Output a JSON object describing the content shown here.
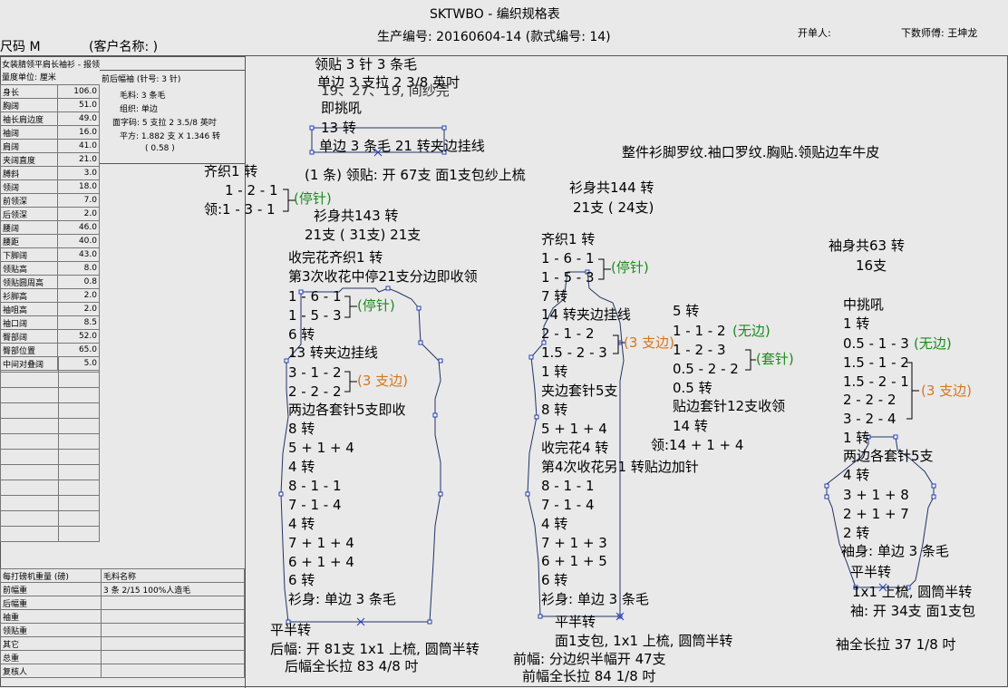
{
  "header": {
    "title": "SKTWBO - 编织规格表",
    "production": "生产编号: 20160604-14  (款式编号: 14)",
    "size": "尺码  M",
    "customer": "(客户名称:                    )",
    "order_person": "开单人:",
    "master": "下数师傅: 王坤龙"
  },
  "left": {
    "title": "女装腈领平肩长袖衫 - 报领",
    "unit": "量度单位: 厘米",
    "rows": [
      {
        "label": "身长",
        "value": "106.0"
      },
      {
        "label": "胸阔",
        "value": "51.0"
      },
      {
        "label": "袖长肩边度",
        "value": "49.0"
      },
      {
        "label": "袖阔",
        "value": "16.0"
      },
      {
        "label": "肩阔",
        "value": "41.0"
      },
      {
        "label": "夹阔直度",
        "value": "21.0"
      },
      {
        "label": "膊斜",
        "value": "3.0"
      },
      {
        "label": "领阔",
        "value": "18.0"
      },
      {
        "label": "前领深",
        "value": "7.0"
      },
      {
        "label": "后领深",
        "value": "2.0"
      },
      {
        "label": "腰阔",
        "value": "46.0"
      },
      {
        "label": "腰距",
        "value": "40.0"
      },
      {
        "label": "下脚阔",
        "value": "43.0"
      },
      {
        "label": "领贴高",
        "value": "8.0"
      },
      {
        "label": "领贴圆周高",
        "value": "0.8"
      },
      {
        "label": "衫脚高",
        "value": "2.0"
      },
      {
        "label": "袖咀高",
        "value": "2.0"
      },
      {
        "label": "袖口阔",
        "value": "8.5"
      },
      {
        "label": "臀部阔",
        "value": "52.0"
      },
      {
        "label": "臀部位置",
        "value": "65.0"
      },
      {
        "label": "中间对叠阔",
        "value": "5.0"
      }
    ],
    "yarn": {
      "header": "前后幅袖 (针号: 3 针)",
      "material": "毛料: 3 条毛",
      "stitch": "组织: 单边",
      "gauge": "面字码: 5 支拉 2 3.5/8 英吋",
      "flat": "平方: 1.882 支 X 1.346 转",
      "flat2": "( 0.58 )"
    },
    "bottom_header": [
      "每打磅机重量 (磅)",
      "毛料名称"
    ],
    "bottom_rows": [
      {
        "label": "前幅重",
        "value": "3 条 2/15 100%人造毛"
      },
      {
        "label": "后幅重",
        "value": ""
      },
      {
        "label": "袖重",
        "value": ""
      },
      {
        "label": "领贴重",
        "value": ""
      },
      {
        "label": "其它",
        "value": ""
      },
      {
        "label": "总重",
        "value": ""
      },
      {
        "label": "复核人",
        "value": ""
      }
    ]
  },
  "collar": {
    "l1": "领贴  3 针 3 条毛",
    "l2": "单边 3 支拉 2 3/8 英吋",
    "l3": "19、27、19, 间纱完",
    "l4": "即挑吼",
    "l5": "13 转",
    "l6": "单边 3 条毛      21 转夹边挂线",
    "l7": "(1 条) 领贴: 开 67支  面1支包纱上梳"
  },
  "note": "整件衫脚罗纹.袖口罗纹.胸贴.领贴边车牛皮",
  "back": {
    "top1": "齐织1 转",
    "r1": "1 - 2 - 1",
    "r2": "领:1 - 3 - 1",
    "stop": "(停针)",
    "body1": "衫身共143 转",
    "body2": "21支 ( 31支) 21支",
    "c1": "收完花齐织1 转",
    "c2": "第3次收花中停21支分边即收领",
    "a1": "1 - 6 - 1",
    "a2": "1 - 5 - 3",
    "astop": "(停针)",
    "a3": "6 转",
    "a4": "13 转夹边挂线",
    "a5": "3 - 1 - 2",
    "a6": "2 - 2 - 2",
    "aedge": "(3 支边)",
    "a7": "两边各套针5支即收",
    "b1": "8 转",
    "b2": "5 + 1 + 4",
    "b3": "4 转",
    "b4": "8 - 1 - 1",
    "b5": "7 - 1 - 4",
    "b6": "4 转",
    "b7": "7 + 1 + 4",
    "b8": "6 + 1 + 4",
    "b9": "6 转",
    "b10": "衫身: 单边 3 条毛",
    "f1": "平半转",
    "f2": "后幅: 开 81支  1x1 上梳, 圆筒半转",
    "f3": "后幅全长拉 83 4/8 吋"
  },
  "front": {
    "body1": "衫身共144 转",
    "body2": "21支 ( 24支)",
    "c1": "齐织1 转",
    "a1": "1 - 6 - 1",
    "a2": "1 - 5 - 3",
    "astop": "(停针)",
    "a3": "7 转",
    "a4": "14 转夹边挂线",
    "a5": "2 - 1 - 2",
    "a6": "1.5 - 2 - 3",
    "aedge": "(3 支边)",
    "a7": "1 转",
    "a8": "夹边套针5支",
    "b1": "8 转",
    "b2": "5 + 1 + 4",
    "b3": "收完花4 转",
    "b4": "第4次收花另1 转贴边加针",
    "b5": "8 - 1 - 1",
    "b6": "7 - 1 - 4",
    "b7": "4 转",
    "b8": "7 + 1 + 3",
    "b9": "6 + 1 + 5",
    "b10": "6 转",
    "b11": "衫身: 单边 3 条毛",
    "f1": "平半转",
    "f2": "面1支包, 1x1 上梳, 圆筒半转",
    "f3": "前幅: 分边织半幅开 47支",
    "f4": "前幅全长拉 84 1/8 吋",
    "n1": "5 转",
    "n2": "1 - 1 - 2",
    "n2b": "(无边)",
    "n3": "1 - 2 - 3",
    "n3b": "(套针)",
    "n4": "0.5 - 2 - 2",
    "n5": "0.5 转",
    "n6": "贴边套针12支收领",
    "n7": "14 转",
    "n8": "领:14 + 1 + 4"
  },
  "sleeve": {
    "s1": "袖身共63 转",
    "s2": "16支",
    "s3": "中挑吼",
    "s4": "1 转",
    "s5": "0.5 - 1 - 3",
    "s5b": "(无边)",
    "s6": "1.5 - 1 - 2",
    "s7": "1.5 - 2 - 1",
    "s8": "2 - 2 - 2",
    "s9": "3 - 2 - 4",
    "sedge": "(3 支边)",
    "s10": "1 转",
    "s11": "两边各套针5支",
    "s12": "4 转",
    "s13": "3 + 1 + 8",
    "s14": "2 + 1 + 7",
    "s15": "2 转",
    "s16": "袖身: 单边 3 条毛",
    "s17": "平半转",
    "s18": "1x1 上梳, 圆筒半转",
    "s19": "袖: 开 34支  面1支包",
    "s20": "袖全长拉 37 1/8 吋"
  }
}
